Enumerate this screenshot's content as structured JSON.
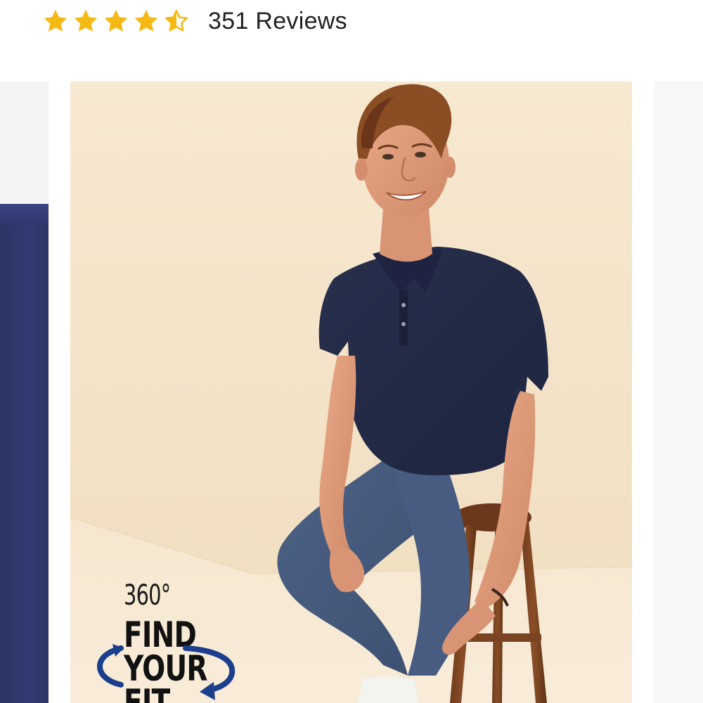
{
  "rating": {
    "value": 4.5,
    "max": 5,
    "star_color": "#f5b915",
    "stars": [
      "star-full-icon",
      "star-full-icon",
      "star-full-icon",
      "star-full-icon",
      "star-half-icon"
    ],
    "review_count_label": "351 Reviews"
  },
  "carousel": {
    "main_image": "man-seated-on-stool-in-navy-polo-and-blue-chinos",
    "badge": {
      "degrees": "360°",
      "line1": "FIND",
      "line2": "YOUR",
      "line3": "FIT",
      "arrow_color": "#1b3f8c"
    }
  }
}
